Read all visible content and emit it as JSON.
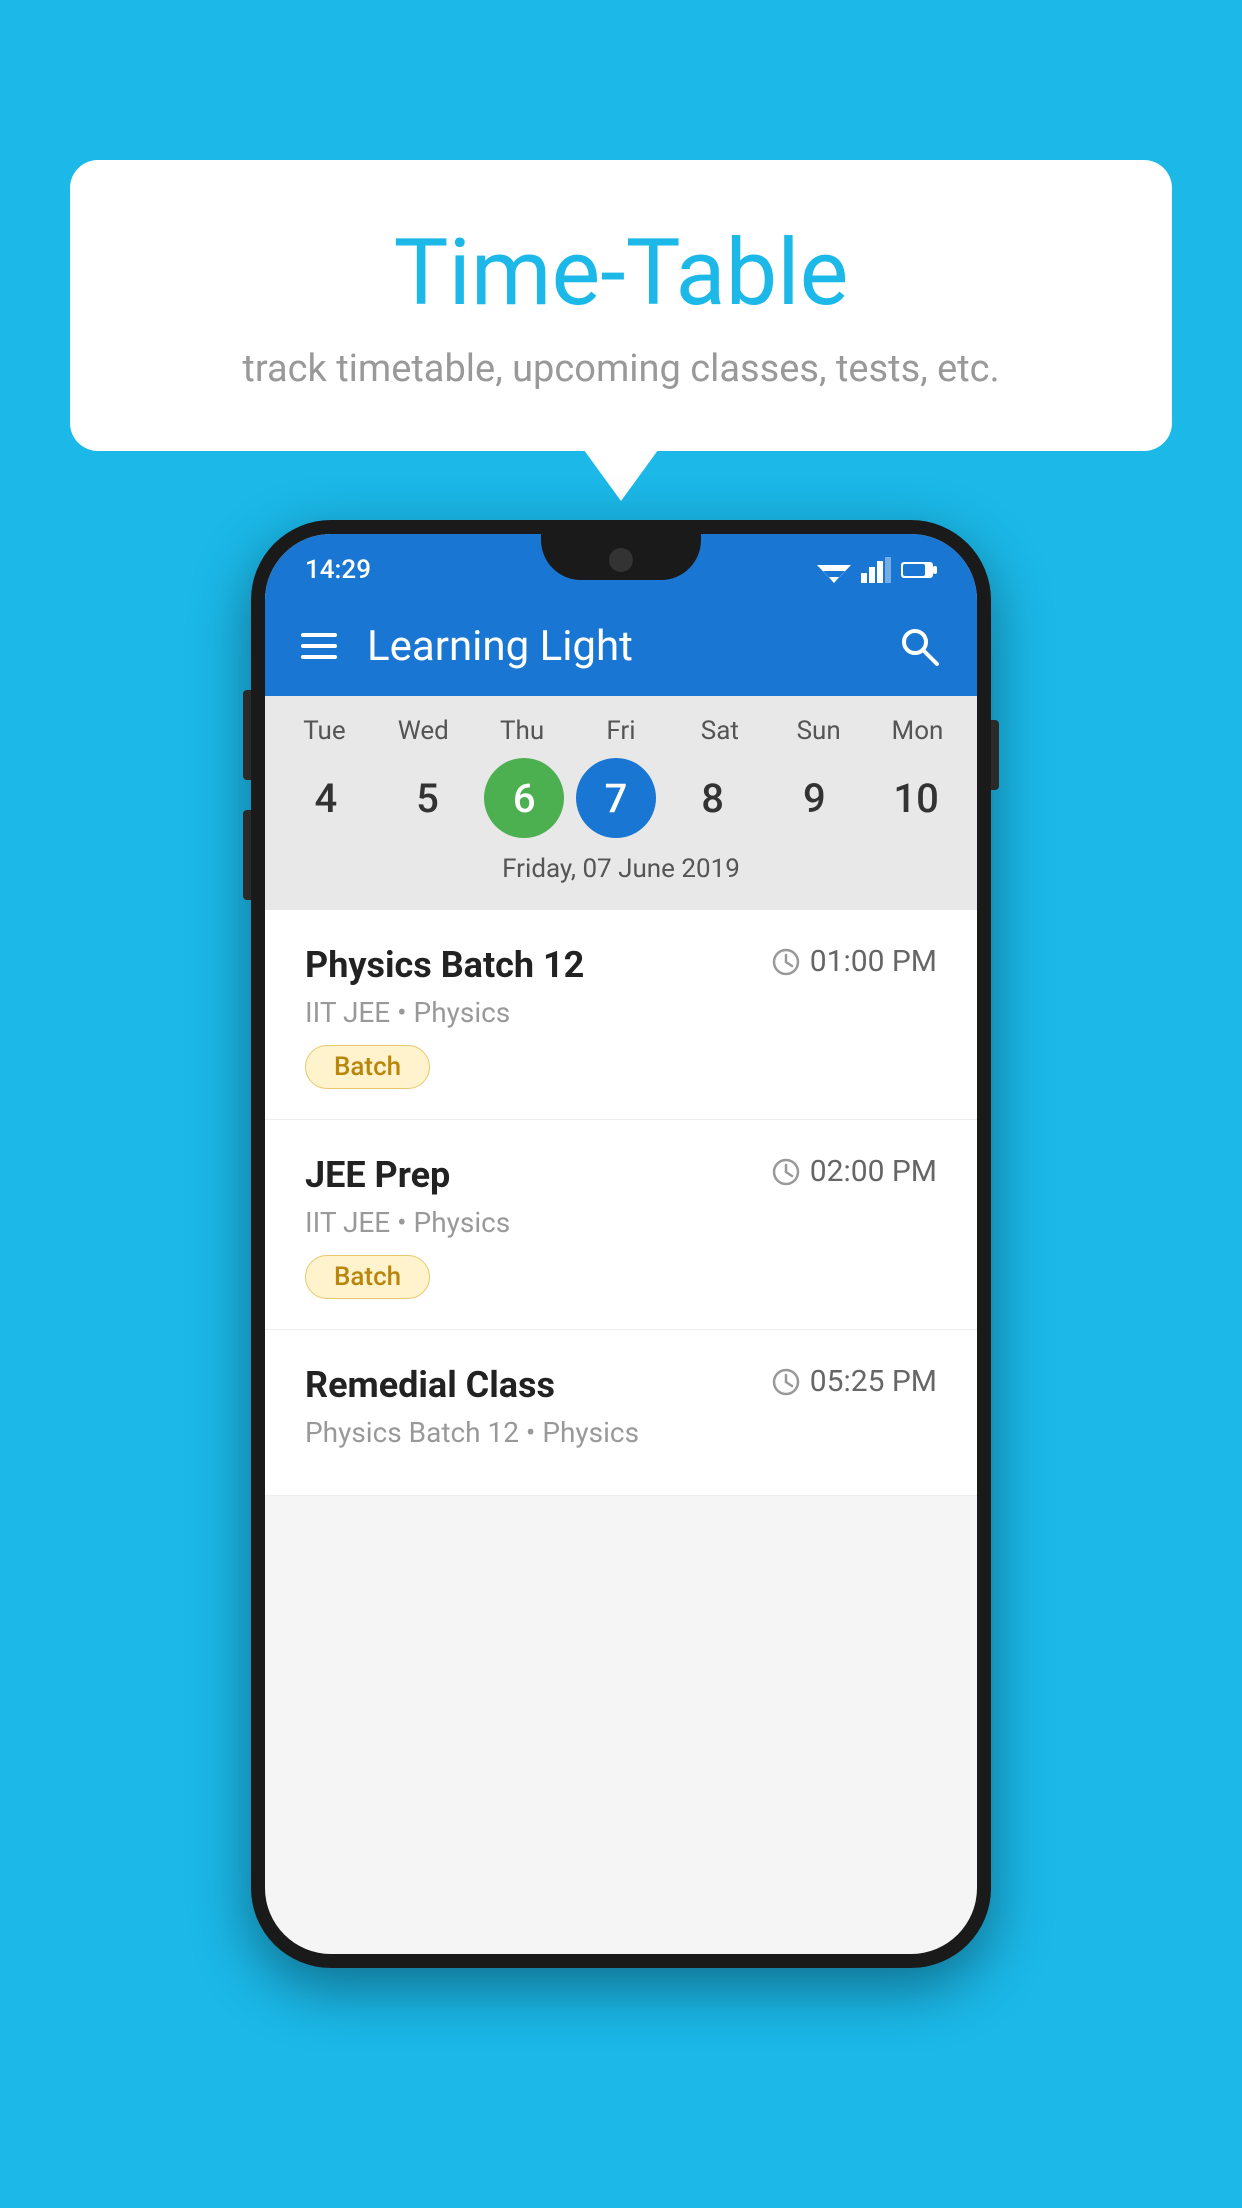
{
  "background_color": "#1BB8E8",
  "bubble": {
    "title": "Time-Table",
    "subtitle": "track timetable, upcoming classes, tests, etc."
  },
  "phone": {
    "status_bar": {
      "time": "14:29"
    },
    "app_bar": {
      "title": "Learning Light"
    },
    "calendar": {
      "days": [
        {
          "label": "Tue",
          "number": "4"
        },
        {
          "label": "Wed",
          "number": "5"
        },
        {
          "label": "Thu",
          "number": "6",
          "state": "today"
        },
        {
          "label": "Fri",
          "number": "7",
          "state": "selected"
        },
        {
          "label": "Sat",
          "number": "8"
        },
        {
          "label": "Sun",
          "number": "9"
        },
        {
          "label": "Mon",
          "number": "10"
        }
      ],
      "selected_date_label": "Friday, 07 June 2019"
    },
    "schedule": [
      {
        "title": "Physics Batch 12",
        "time": "01:00 PM",
        "subtitle": "IIT JEE • Physics",
        "badge": "Batch"
      },
      {
        "title": "JEE Prep",
        "time": "02:00 PM",
        "subtitle": "IIT JEE • Physics",
        "badge": "Batch"
      },
      {
        "title": "Remedial Class",
        "time": "05:25 PM",
        "subtitle": "Physics Batch 12 • Physics",
        "badge": null
      }
    ]
  }
}
